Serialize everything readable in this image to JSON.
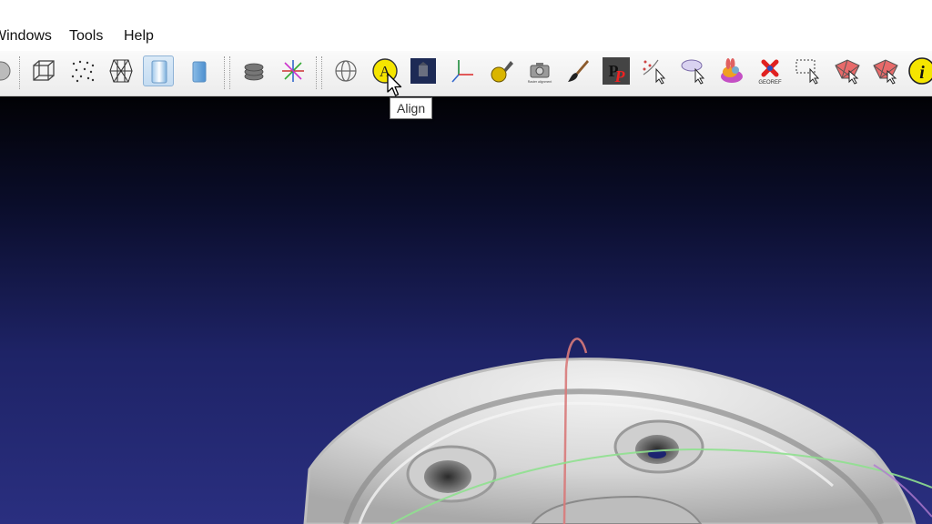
{
  "menu": {
    "windows_label": "Windows",
    "tools_label": "Tools",
    "help_label": "Help"
  },
  "toolbar": {
    "tooltip": "Align",
    "snapshot_caption": "Raster alignment",
    "georef_label": "GEOREF",
    "info_label": "i",
    "align_letter": "A",
    "paint_letters": "PP"
  },
  "colors": {
    "active_button": "#c9def3",
    "align_icon": "#f5e500",
    "viewport_top": "#020205",
    "viewport_bottom": "#2a2f80",
    "mesh": "#e4e4e4"
  }
}
